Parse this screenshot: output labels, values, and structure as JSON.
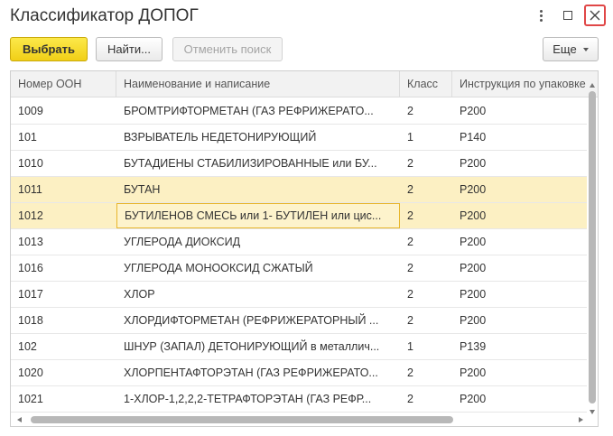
{
  "window": {
    "title": "Классификатор ДОПОГ"
  },
  "toolbar": {
    "select_label": "Выбрать",
    "find_label": "Найти...",
    "cancel_search_label": "Отменить поиск",
    "more_label": "Еще"
  },
  "table": {
    "columns": [
      "Номер ООН",
      "Наименование и написание",
      "Класс",
      "Инструкция по упаковке"
    ],
    "rows": [
      {
        "num": "1009",
        "name": "БРОМТРИФТОРМЕТАН (ГАЗ РЕФРИЖЕРАТО...",
        "cls": "2",
        "instr": "P200"
      },
      {
        "num": "101",
        "name": "ВЗРЫВАТЕЛЬ НЕДЕТОНИРУЮЩИЙ",
        "cls": "1",
        "instr": "P140"
      },
      {
        "num": "1010",
        "name": "БУТАДИЕНЫ СТАБИЛИЗИРОВАННЫЕ или БУ...",
        "cls": "2",
        "instr": "P200"
      },
      {
        "num": "1011",
        "name": "БУТАН",
        "cls": "2",
        "instr": "P200"
      },
      {
        "num": "1012",
        "name": "БУТИЛЕНОВ СМЕСЬ или 1- БУТИЛЕН или цис...",
        "cls": "2",
        "instr": "P200"
      },
      {
        "num": "1013",
        "name": "УГЛЕРОДА ДИОКСИД",
        "cls": "2",
        "instr": "P200"
      },
      {
        "num": "1016",
        "name": "УГЛЕРОДА МОНООКСИД СЖАТЫЙ",
        "cls": "2",
        "instr": "P200"
      },
      {
        "num": "1017",
        "name": "ХЛОР",
        "cls": "2",
        "instr": "P200"
      },
      {
        "num": "1018",
        "name": "ХЛОРДИФТОРМЕТАН (РЕФРИЖЕРАТОРНЫЙ ...",
        "cls": "2",
        "instr": "P200"
      },
      {
        "num": "102",
        "name": "ШНУР (ЗАПАЛ) ДЕТОНИРУЮЩИЙ в металлич...",
        "cls": "1",
        "instr": "P139"
      },
      {
        "num": "1020",
        "name": "ХЛОРПЕНТАФТОРЭТАН (ГАЗ РЕФРИЖЕРАТО...",
        "cls": "2",
        "instr": "P200"
      },
      {
        "num": "1021",
        "name": "1-ХЛОР-1,2,2,2-ТЕТРАФТОРЭТАН (ГАЗ РЕФР...",
        "cls": "2",
        "instr": "P200"
      }
    ]
  },
  "icons": {
    "menu": "more-vertical-icon",
    "maximize": "maximize-icon",
    "close": "close-icon"
  },
  "colors": {
    "primary_button": "#f1cf17",
    "selected_row": "#fcf0c3",
    "close_highlight": "#e04747"
  }
}
